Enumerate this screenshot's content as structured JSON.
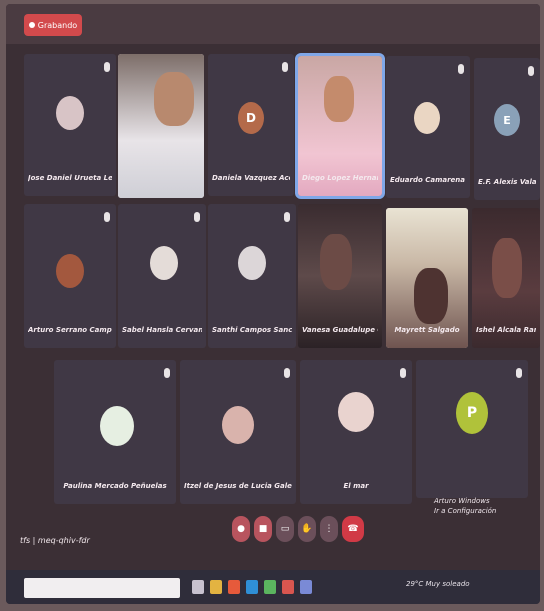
{
  "recording_label": "Grabando",
  "participants": [
    {
      "name": "Jose Daniel Urueta Leyva",
      "initial": "",
      "avatar": "photo"
    },
    {
      "name": "",
      "initial": "",
      "avatar": "video"
    },
    {
      "name": "Daniela Vazquez Acevedo",
      "initial": "D",
      "avatar": "letter"
    },
    {
      "name": "Diego Lopez Hernandez",
      "initial": "",
      "avatar": "video"
    },
    {
      "name": "Eduardo Camarena Zacarias",
      "initial": "",
      "avatar": "photo"
    },
    {
      "name": "E.F. Alexis Valadez Delgado",
      "initial": "E",
      "avatar": "letter"
    },
    {
      "name": "Arturo Serrano Campos",
      "initial": "",
      "avatar": "photo"
    },
    {
      "name": "Sabel Hansla Cervantes Jo..",
      "initial": "",
      "avatar": "photo"
    },
    {
      "name": "Santhi Campos Sanchez",
      "initial": "",
      "avatar": "photo"
    },
    {
      "name": "Vanesa Guadalupe Osuna",
      "initial": "",
      "avatar": "video"
    },
    {
      "name": "Mayrett Salgado",
      "initial": "",
      "avatar": "video"
    },
    {
      "name": "Ishel Alcala Ramírez",
      "initial": "",
      "avatar": "video"
    },
    {
      "name": "Paulina Mercado Peñuelas",
      "initial": "",
      "avatar": "photo"
    },
    {
      "name": "Itzel de Jesus de Lucia Galeano",
      "initial": "",
      "avatar": "photo"
    },
    {
      "name": "El mar",
      "initial": "",
      "avatar": "photo"
    },
    {
      "name": "",
      "initial": "P",
      "avatar": "letter"
    }
  ],
  "meeting_code": "tfs | meq-qhiv-fdr",
  "side_panel": {
    "line1": "Arturo Windows",
    "line2": "Ir a Configuración"
  },
  "tray_text": "29°C Muy soleado",
  "colors": {
    "accent": "#d24a4c",
    "active_speaker": "#7fa7e8",
    "letter_d": "#b46a4a",
    "letter_e": "#8aa1b8",
    "letter_p": "#b0c23a"
  }
}
